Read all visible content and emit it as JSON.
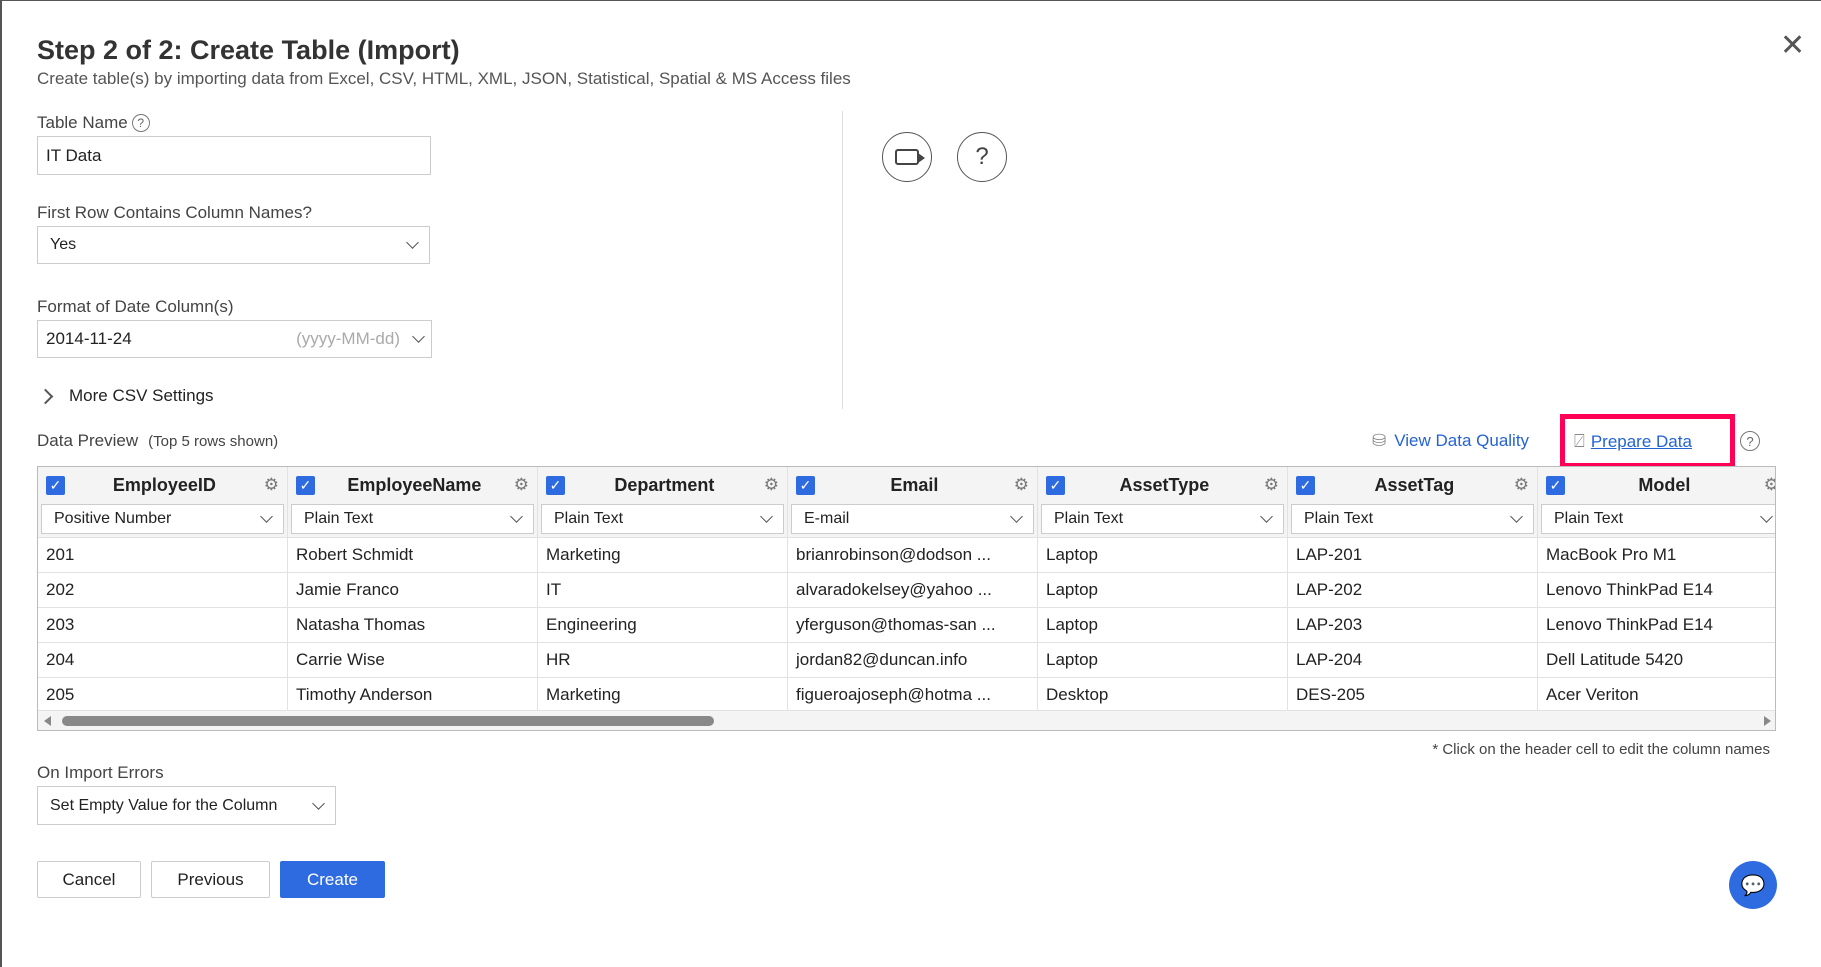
{
  "header": {
    "title": "Step 2 of 2: Create Table (Import)",
    "subtitle": "Create table(s) by importing data from Excel, CSV, HTML, XML, JSON, Statistical, Spatial & MS Access files"
  },
  "form": {
    "table_name_label": "Table Name",
    "table_name_value": "IT Data",
    "first_row_label": "First Row Contains Column Names?",
    "first_row_value": "Yes",
    "date_format_label": "Format of Date Column(s)",
    "date_format_value": "2014-11-24",
    "date_format_hint": "(yyyy-MM-dd)",
    "more_settings": "More CSV Settings"
  },
  "preview": {
    "label": "Data Preview",
    "note": "(Top 5 rows shown)",
    "view_quality": "View Data Quality",
    "prepare_data": "Prepare Data",
    "footnote": "* Click on the header cell to edit the column names",
    "columns": [
      {
        "name": "EmployeeID",
        "type": "Positive Number",
        "cells": [
          "201",
          "202",
          "203",
          "204",
          "205"
        ]
      },
      {
        "name": "EmployeeName",
        "type": "Plain Text",
        "cells": [
          "Robert Schmidt",
          "Jamie Franco",
          "Natasha Thomas",
          "Carrie Wise",
          "Timothy Anderson"
        ]
      },
      {
        "name": "Department",
        "type": "Plain Text",
        "cells": [
          "Marketing",
          "IT",
          "Engineering",
          "HR",
          "Marketing"
        ]
      },
      {
        "name": "Email",
        "type": "E-mail",
        "cells": [
          "brianrobinson@dodson ...",
          "alvaradokelsey@yahoo ...",
          "yferguson@thomas-san ...",
          "jordan82@duncan.info",
          "figueroajoseph@hotma ..."
        ]
      },
      {
        "name": "AssetType",
        "type": "Plain Text",
        "cells": [
          "Laptop",
          "Laptop",
          "Laptop",
          "Laptop",
          "Desktop"
        ]
      },
      {
        "name": "AssetTag",
        "type": "Plain Text",
        "cells": [
          "LAP-201",
          "LAP-202",
          "LAP-203",
          "LAP-204",
          "DES-205"
        ]
      },
      {
        "name": "Model",
        "type": "Plain Text",
        "cells": [
          "MacBook Pro M1",
          "Lenovo ThinkPad E14",
          "Lenovo ThinkPad E14",
          "Dell Latitude 5420",
          "Acer Veriton"
        ]
      }
    ]
  },
  "errors": {
    "label": "On Import Errors",
    "value": "Set Empty Value for the Column"
  },
  "buttons": {
    "cancel": "Cancel",
    "previous": "Previous",
    "create": "Create"
  },
  "colors": {
    "accent": "#2f6be0",
    "highlight": "#ff0055"
  }
}
